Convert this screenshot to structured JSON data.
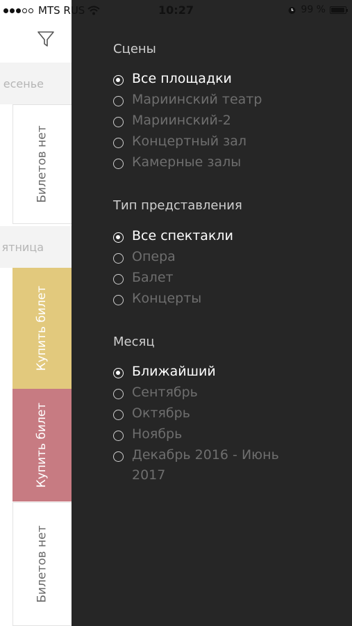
{
  "status_bar": {
    "carrier": "MTS RUS",
    "time": "10:27",
    "battery": "99 %"
  },
  "underlay": {
    "day_labels": [
      "есенье",
      "ятница"
    ],
    "cards": [
      {
        "label": "Билетов нет",
        "style": "white"
      },
      {
        "label": "Купить билет",
        "style": "yellow",
        "color": "#e2c97d"
      },
      {
        "label": "Купить билет",
        "style": "pink",
        "color": "#c77b82"
      },
      {
        "label": "Билетов нет",
        "style": "white"
      }
    ]
  },
  "filters": {
    "background": "#262626",
    "groups": [
      {
        "title": "Сцены",
        "options": [
          "Все площадки",
          "Мариинский театр",
          "Мариинский-2",
          "Концертный зал",
          "Камерные залы"
        ],
        "selected": 0
      },
      {
        "title": "Тип представления",
        "options": [
          "Все спектакли",
          "Опера",
          "Балет",
          "Концерты"
        ],
        "selected": 0
      },
      {
        "title": "Месяц",
        "options": [
          "Ближайший",
          "Сентябрь",
          "Октябрь",
          "Ноябрь",
          "Декабрь 2016 - Июнь 2017"
        ],
        "selected": 0
      }
    ]
  },
  "icons": [
    "filter-icon",
    "wifi-icon",
    "alarm-icon",
    "battery-icon",
    "radio-icon"
  ]
}
